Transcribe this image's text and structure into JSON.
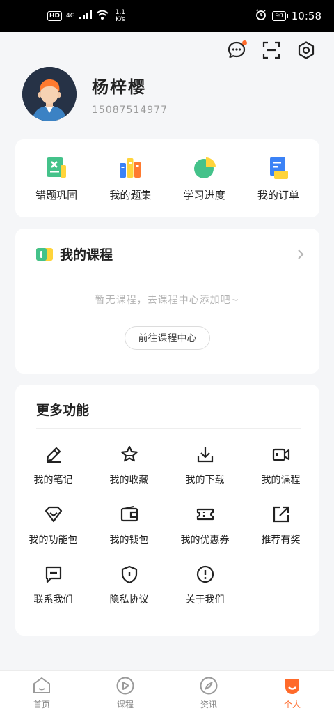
{
  "status_bar": {
    "hd": "HD",
    "net_type": "4G",
    "speed": "1.1",
    "speed_unit": "K/s",
    "battery": "90",
    "time": "10:58"
  },
  "profile": {
    "name": "杨梓樱",
    "phone": "15087514977"
  },
  "quick_tools": [
    {
      "label": "错题巩固",
      "icon": "wrong-questions-icon"
    },
    {
      "label": "我的题集",
      "icon": "question-set-icon"
    },
    {
      "label": "学习进度",
      "icon": "progress-pie-icon"
    },
    {
      "label": "我的订单",
      "icon": "order-icon"
    }
  ],
  "courses": {
    "title": "我的课程",
    "empty_text": "暂无课程，去课程中心添加吧~",
    "button": "前往课程中心"
  },
  "more": {
    "title": "更多功能",
    "items": [
      {
        "label": "我的笔记",
        "icon": "pencil-icon"
      },
      {
        "label": "我的收藏",
        "icon": "star-icon"
      },
      {
        "label": "我的下载",
        "icon": "download-icon"
      },
      {
        "label": "我的课程",
        "icon": "video-icon"
      },
      {
        "label": "我的功能包",
        "icon": "package-icon"
      },
      {
        "label": "我的钱包",
        "icon": "wallet-icon"
      },
      {
        "label": "我的优惠券",
        "icon": "coupon-icon"
      },
      {
        "label": "推荐有奖",
        "icon": "share-icon"
      },
      {
        "label": "联系我们",
        "icon": "message-icon"
      },
      {
        "label": "隐私协议",
        "icon": "shield-icon"
      },
      {
        "label": "关于我们",
        "icon": "info-icon"
      }
    ]
  },
  "bottom_nav": [
    {
      "label": "首页",
      "icon": "home-icon"
    },
    {
      "label": "课程",
      "icon": "play-icon"
    },
    {
      "label": "资讯",
      "icon": "compass-icon"
    },
    {
      "label": "个人",
      "icon": "person-icon"
    }
  ],
  "colors": {
    "accent": "#ff6a2a",
    "background": "#f5f6f8",
    "card": "#ffffff"
  }
}
